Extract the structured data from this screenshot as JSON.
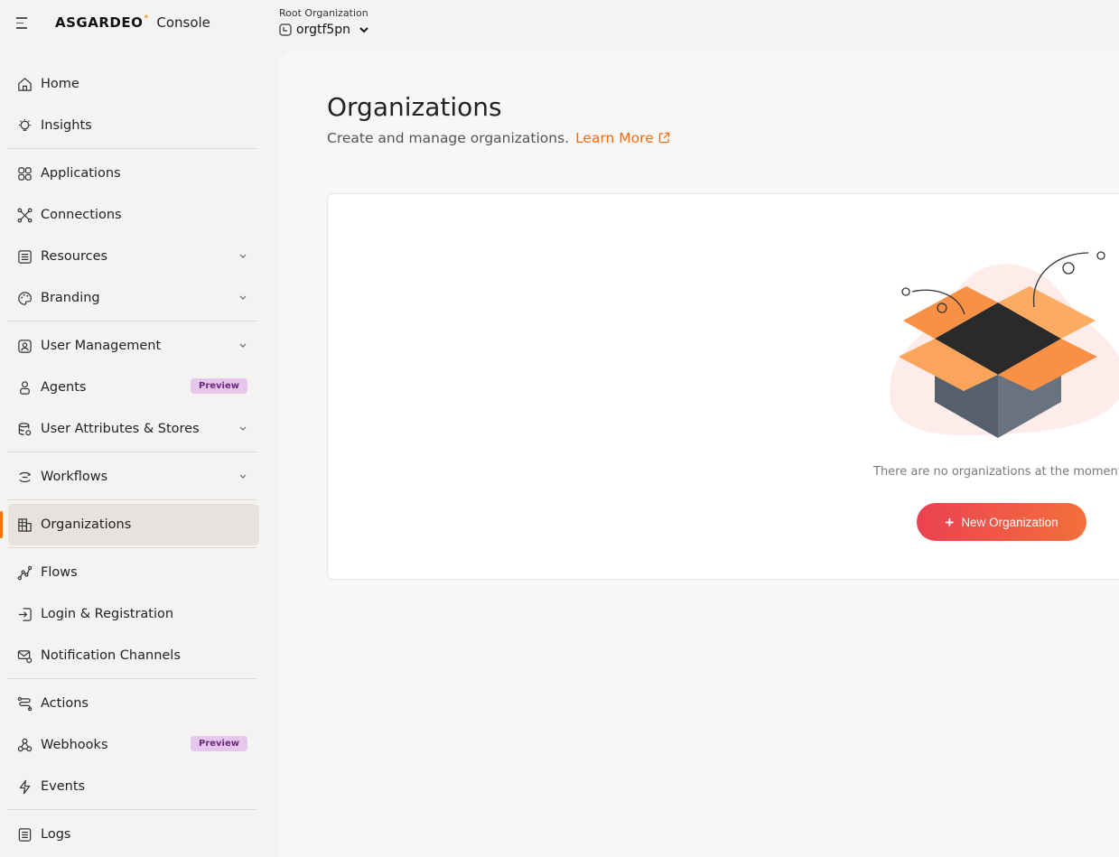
{
  "header": {
    "logo_text": "ASGARDEO",
    "logo_star": "*",
    "console_label": "Console",
    "org_label": "Root Organization",
    "org_name": "orgtf5pn"
  },
  "sidebar": {
    "items": [
      {
        "label": "Home",
        "icon": "home-icon"
      },
      {
        "label": "Insights",
        "icon": "bulb-icon"
      },
      {
        "label": "Applications",
        "icon": "grid-icon"
      },
      {
        "label": "Connections",
        "icon": "connections-icon"
      },
      {
        "label": "Resources",
        "icon": "resources-icon"
      },
      {
        "label": "Branding",
        "icon": "palette-icon"
      },
      {
        "label": "User Management",
        "icon": "user-icon"
      },
      {
        "label": "Agents",
        "icon": "agent-icon",
        "badge": "Preview"
      },
      {
        "label": "User Attributes & Stores",
        "icon": "database-icon"
      },
      {
        "label": "Workflows",
        "icon": "workflow-icon"
      },
      {
        "label": "Organizations",
        "icon": "building-icon"
      },
      {
        "label": "Flows",
        "icon": "flow-icon"
      },
      {
        "label": "Login & Registration",
        "icon": "login-icon"
      },
      {
        "label": "Notification Channels",
        "icon": "mail-settings-icon"
      },
      {
        "label": "Actions",
        "icon": "actions-icon"
      },
      {
        "label": "Webhooks",
        "icon": "webhook-icon",
        "badge": "Preview"
      },
      {
        "label": "Events",
        "icon": "bolt-icon"
      },
      {
        "label": "Logs",
        "icon": "log-icon"
      }
    ]
  },
  "main": {
    "title": "Organizations",
    "subtitle": "Create and manage organizations.",
    "learn_more": "Learn More",
    "empty_message": "There are no organizations at the moment.",
    "new_button": "New Organization",
    "new_button_icon": "+"
  },
  "colors": {
    "accent": "#ff7300",
    "button_start": "#eb4152",
    "button_end": "#f4703b",
    "badge_bg": "#e6c6ec"
  }
}
